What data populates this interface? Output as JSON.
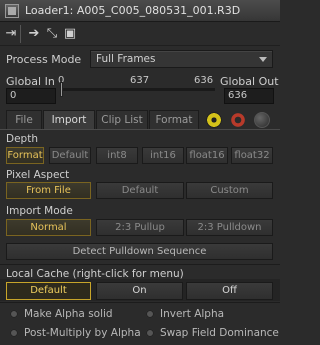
{
  "window": {
    "title": "Loader1: A005_C005_080531_001.R3D"
  },
  "toolbar": {
    "icons": [
      "pin-icon",
      "forward-arrow-icon",
      "link-icon",
      "save-icon"
    ],
    "glyphs": [
      "⇥",
      "➔",
      "⤡",
      "▣"
    ]
  },
  "process_mode": {
    "label": "Process Mode",
    "value": "Full Frames"
  },
  "range": {
    "global_in_label": "Global In",
    "global_out_label": "Global Out",
    "global_in_value": "0",
    "global_out_value": "636",
    "tick_start": "0",
    "tick_mid": "637",
    "tick_end": "636"
  },
  "tabs": [
    {
      "label": "File"
    },
    {
      "label": "Import"
    },
    {
      "label": "Clip List"
    },
    {
      "label": "Format"
    }
  ],
  "depth": {
    "label": "Depth",
    "options": [
      "Format",
      "Default",
      "int8",
      "int16",
      "float16",
      "float32"
    ],
    "selected": "Format"
  },
  "pixel_aspect": {
    "label": "Pixel Aspect",
    "options": [
      "From File",
      "Default",
      "Custom"
    ],
    "selected": "From File"
  },
  "import_mode": {
    "label": "Import Mode",
    "options": [
      "Normal",
      "2:3 Pullup",
      "2:3 Pulldown"
    ],
    "selected": "Normal",
    "detect_label": "Detect Pulldown Sequence"
  },
  "local_cache": {
    "label": "Local Cache (right-click for menu)",
    "options": [
      "Default",
      "On",
      "Off"
    ],
    "selected": "Default"
  },
  "checks": {
    "make_alpha_solid": "Make Alpha solid",
    "invert_alpha": "Invert Alpha",
    "post_multiply": "Post-Multiply by Alpha",
    "swap_field": "Swap Field Dominance"
  },
  "colors": {
    "accent_yellow": "#e6c25a",
    "background": "#2b2b2b",
    "radioactive_icon": "#d4c21a",
    "gear_icon": "#b83a2a"
  }
}
